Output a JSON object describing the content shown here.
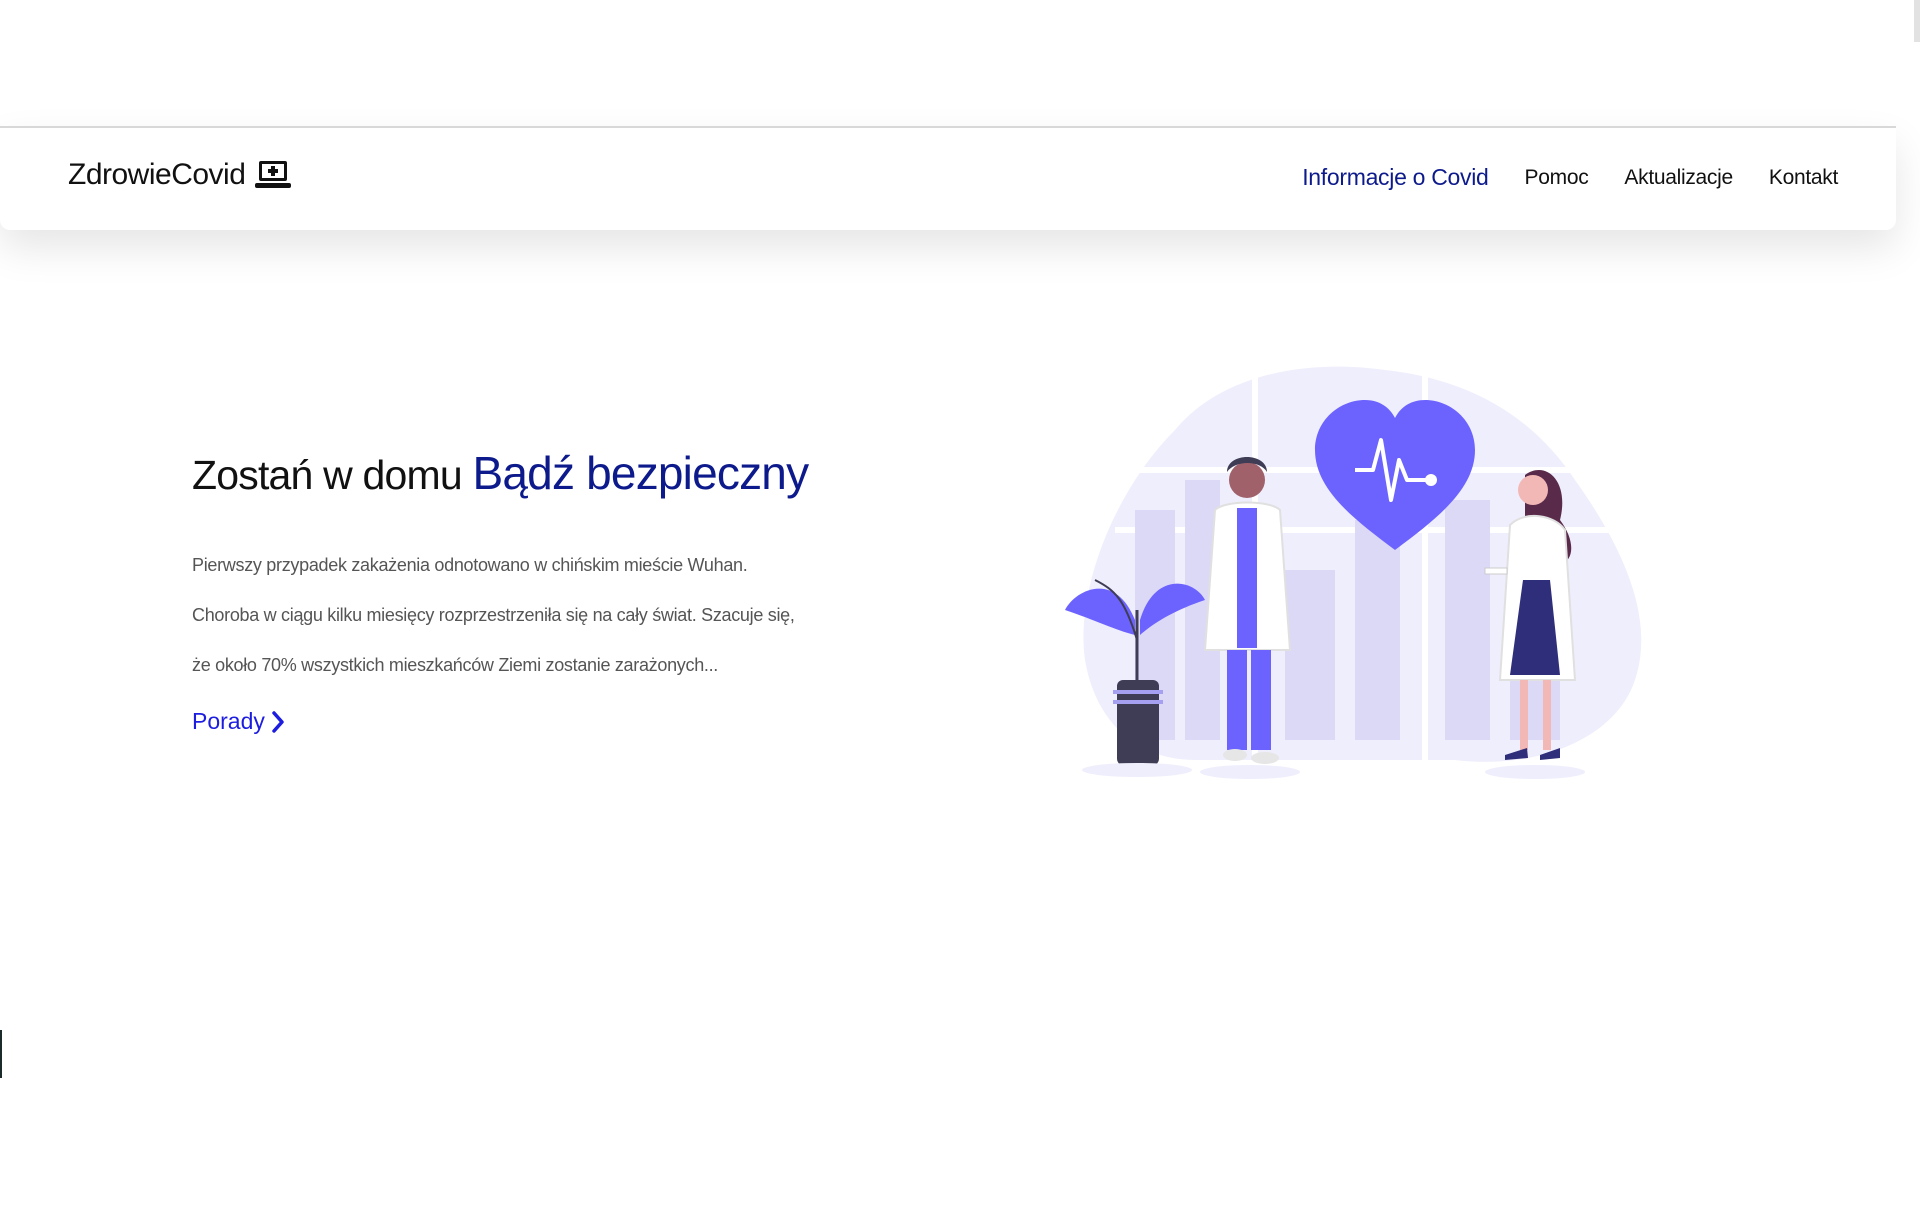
{
  "brand": {
    "name": "ZdrowieCovid",
    "icon": "laptop-medical-icon"
  },
  "nav": {
    "items": [
      {
        "label": "Informacje o Covid",
        "active": true
      },
      {
        "label": "Pomoc",
        "active": false
      },
      {
        "label": "Aktualizacje",
        "active": false
      },
      {
        "label": "Kontakt",
        "active": false
      }
    ]
  },
  "hero": {
    "title_plain": "Zostań w domu",
    "title_accent": "Bądź bezpieczny",
    "paragraph_lines": [
      "Pierwszy przypadek zakażenia odnotowano w chińskim mieście Wuhan.",
      "Choroba w ciągu kilku miesięcy rozprzestrzeniła się na cały świat. Szacuje się,",
      "że około 70% wszystkich mieszkańców Ziemi zostanie zarażonych..."
    ],
    "link_label": "Porady",
    "link_icon": "chevron-right-icon"
  },
  "illustration": {
    "name": "doctors-heart-illustration",
    "colors": {
      "accent": "#6c63ff",
      "light": "#e9e7fb",
      "dark": "#3f3d56"
    }
  },
  "colors": {
    "nav_active": "#0d1a8c",
    "link": "#1d1de0",
    "text": "#111111",
    "muted": "#555555"
  }
}
